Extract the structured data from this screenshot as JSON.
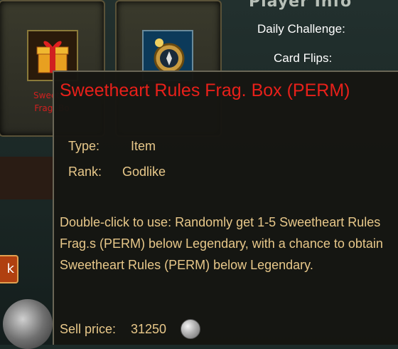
{
  "header": {
    "title": "Player Info"
  },
  "player_info": {
    "daily_challenge_label": "Daily Challenge:",
    "card_flips_label": "Card Flips:"
  },
  "slots": [
    {
      "label_line1": "Sweethe",
      "label_line2": "Frag. Bo",
      "icon": "gift-box-icon"
    },
    {
      "icon": "compass-icon"
    }
  ],
  "left_button": {
    "label": "k"
  },
  "tooltip": {
    "title": "Sweetheart Rules Frag. Box (PERM)",
    "type_label": "Type:",
    "type_value": "Item",
    "rank_label": "Rank:",
    "rank_value": "Godlike",
    "description": "Double-click to use: Randomly get 1-5 Sweetheart Rules Frag.s (PERM) below Legendary, with a chance to obtain Sweetheart Rules (PERM) below Legendary.",
    "sell_label": "Sell price:",
    "sell_value": "31250",
    "currency_icon": "silver-coin-icon"
  },
  "colors": {
    "title": "#e8201a",
    "text": "#e8c88a",
    "slot_label": "#d02020"
  }
}
